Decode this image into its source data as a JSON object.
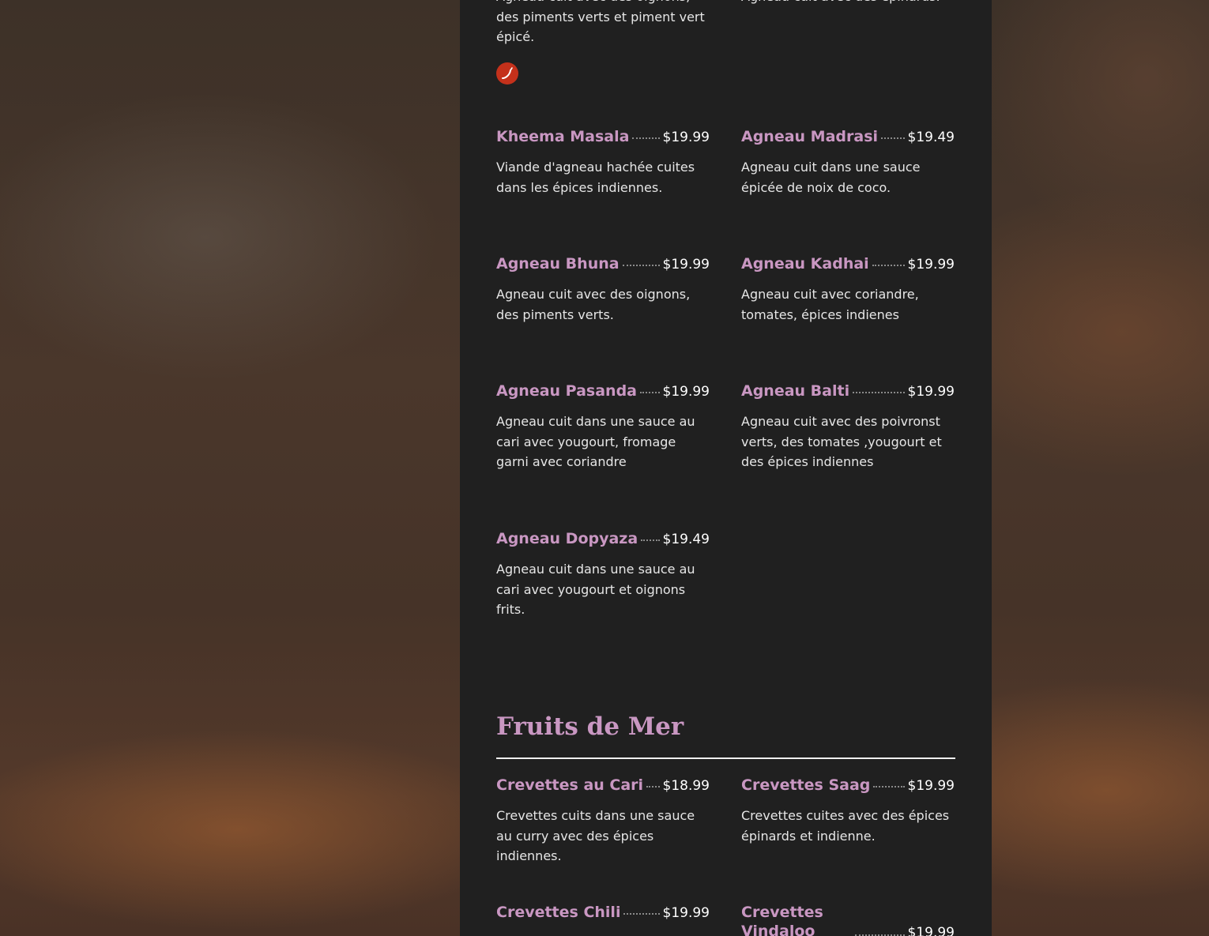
{
  "accent_color": "#c997c2",
  "panel_color": "#202020",
  "spicy_color": "#c4311b",
  "top_partial": {
    "left_desc": "Agneau cuit avec des oignons, des piments verts et piment vert épicé.",
    "left_icon": "chili-pepper-icon",
    "right_desc": "Agneau cuit avec des épinards."
  },
  "lamb_items": [
    {
      "name": "Kheema Masala",
      "price": "$19.99",
      "desc": "Viande d'agneau hachée cuites dans les épices indiennes."
    },
    {
      "name": "Agneau Madrasi",
      "price": "$19.49",
      "desc": "Agneau cuit dans une sauce épicée de noix de coco."
    },
    {
      "name": "Agneau Bhuna",
      "price": "$19.99",
      "desc": "Agneau cuit avec des oignons, des piments verts."
    },
    {
      "name": "Agneau Kadhai",
      "price": "$19.99",
      "desc": "Agneau cuit avec coriandre, tomates, épices indienes"
    },
    {
      "name": "Agneau Pasanda",
      "price": "$19.99",
      "desc": "Agneau cuit dans une sauce au cari avec yougourt, fromage garni avec coriandre"
    },
    {
      "name": "Agneau Balti",
      "price": "$19.99",
      "desc": "Agneau cuit avec des poivronst verts, des tomates ,yougourt et des épices indiennes"
    },
    {
      "name": "Agneau Dopyaza",
      "price": "$19.49",
      "desc": "Agneau cuit dans une sauce au cari avec yougourt et oignons frits."
    }
  ],
  "seafood_section": {
    "title": "Fruits de Mer",
    "items": [
      {
        "name": "Crevettes au Cari",
        "price": "$18.99",
        "desc": "Crevettes cuits dans une sauce au curry avec des épices indiennes."
      },
      {
        "name": "Crevettes Saag",
        "price": "$19.99",
        "desc": "Crevettes cuites avec des épices épinards et indienne."
      },
      {
        "name": "Crevettes Chili",
        "price": "$19.99"
      },
      {
        "name": "Crevettes Vindaloo",
        "price": "$19.99"
      }
    ]
  }
}
